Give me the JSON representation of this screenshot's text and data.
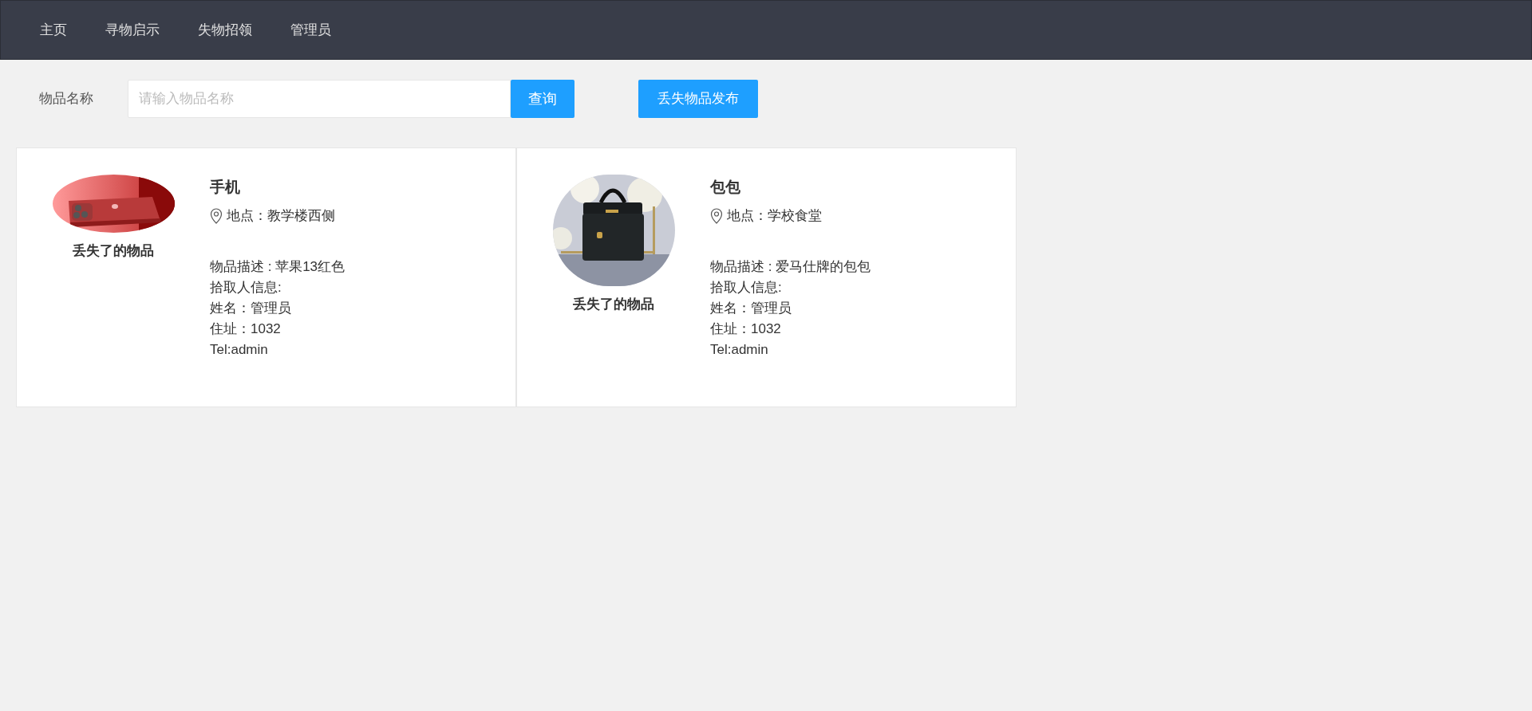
{
  "nav": {
    "items": [
      {
        "label": "主页"
      },
      {
        "label": "寻物启示"
      },
      {
        "label": "失物招领"
      },
      {
        "label": "管理员"
      }
    ]
  },
  "search": {
    "label": "物品名称",
    "placeholder": "请输入物品名称",
    "button": "查询",
    "publish_button": "丢失物品发布"
  },
  "cards": [
    {
      "caption": "丢失了的物品",
      "title": "手机",
      "location": "地点：教学楼西侧",
      "description": "物品描述 : 苹果13红色",
      "finder_heading": "拾取人信息:",
      "name": "姓名：管理员",
      "address": "住址：1032",
      "tel": "Tel:admin"
    },
    {
      "caption": "丢失了的物品",
      "title": "包包",
      "location": "地点：学校食堂",
      "description": "物品描述 : 爱马仕牌的包包",
      "finder_heading": "拾取人信息:",
      "name": "姓名：管理员",
      "address": "住址：1032",
      "tel": "Tel:admin"
    }
  ]
}
